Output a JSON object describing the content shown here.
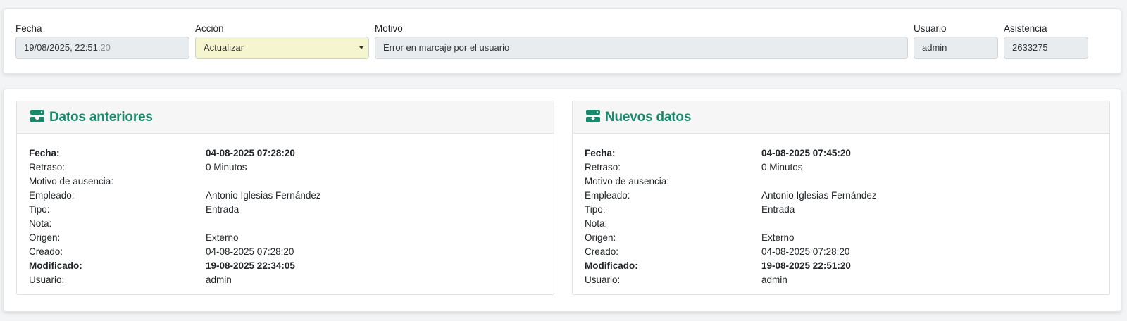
{
  "header": {
    "fecha": {
      "label": "Fecha",
      "value_main": "19/08/2025, 22:51:",
      "value_dim": "20"
    },
    "accion": {
      "label": "Acción",
      "value": "Actualizar"
    },
    "motivo": {
      "label": "Motivo",
      "value": "Error en marcaje por el usuario"
    },
    "usuario": {
      "label": "Usuario",
      "value": "admin"
    },
    "asistencia": {
      "label": "Asistencia",
      "value": "2633275"
    }
  },
  "panels": {
    "anteriores": {
      "title": "Datos anteriores",
      "icon": "database-upload-icon",
      "rows": [
        {
          "key": "Fecha:",
          "value": "04-08-2025 07:28:20"
        },
        {
          "key": "Retraso:",
          "value": "0 Minutos"
        },
        {
          "key": "Motivo de ausencia:",
          "value": ""
        },
        {
          "key": "Empleado:",
          "value": "Antonio Iglesias Fernández"
        },
        {
          "key": "Tipo:",
          "value": "Entrada"
        },
        {
          "key": "Nota:",
          "value": ""
        },
        {
          "key": "Origen:",
          "value": "Externo"
        },
        {
          "key": "Creado:",
          "value": "04-08-2025 07:28:20"
        },
        {
          "key": "Modificado:",
          "value": "19-08-2025 22:34:05"
        },
        {
          "key": "Usuario:",
          "value": "admin"
        }
      ]
    },
    "nuevos": {
      "title": "Nuevos datos",
      "icon": "database-download-icon",
      "rows": [
        {
          "key": "Fecha:",
          "value": "04-08-2025 07:45:20"
        },
        {
          "key": "Retraso:",
          "value": "0 Minutos"
        },
        {
          "key": "Motivo de ausencia:",
          "value": ""
        },
        {
          "key": "Empleado:",
          "value": "Antonio Iglesias Fernández"
        },
        {
          "key": "Tipo:",
          "value": "Entrada"
        },
        {
          "key": "Nota:",
          "value": ""
        },
        {
          "key": "Origen:",
          "value": "Externo"
        },
        {
          "key": "Creado:",
          "value": "04-08-2025 07:28:20"
        },
        {
          "key": "Modificado:",
          "value": "19-08-2025 22:51:20"
        },
        {
          "key": "Usuario:",
          "value": "admin"
        }
      ]
    }
  },
  "colors": {
    "accent": "#168a6a",
    "select_bg": "#f5f6cf",
    "readonly_bg": "#e9ecef"
  }
}
